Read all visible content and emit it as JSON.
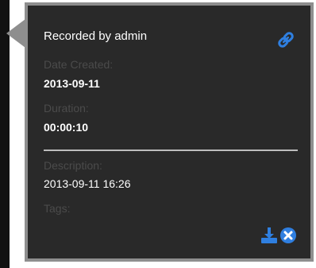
{
  "recording": {
    "title": "Recorded by admin",
    "date_created_label": "Date Created:",
    "date_created_value": "2013-09-11",
    "duration_label": "Duration:",
    "duration_value": "00:00:10",
    "description_label": "Description:",
    "description_value": "2013-09-11 16:26",
    "tags_label": "Tags:"
  },
  "icons": {
    "link": "link-icon",
    "download": "download-icon",
    "close": "close-icon"
  },
  "colors": {
    "panel_background": "#292929",
    "panel_border": "#8e8e8e",
    "accent_blue": "#2f7fe0",
    "label_gray": "#4b4b4b"
  }
}
